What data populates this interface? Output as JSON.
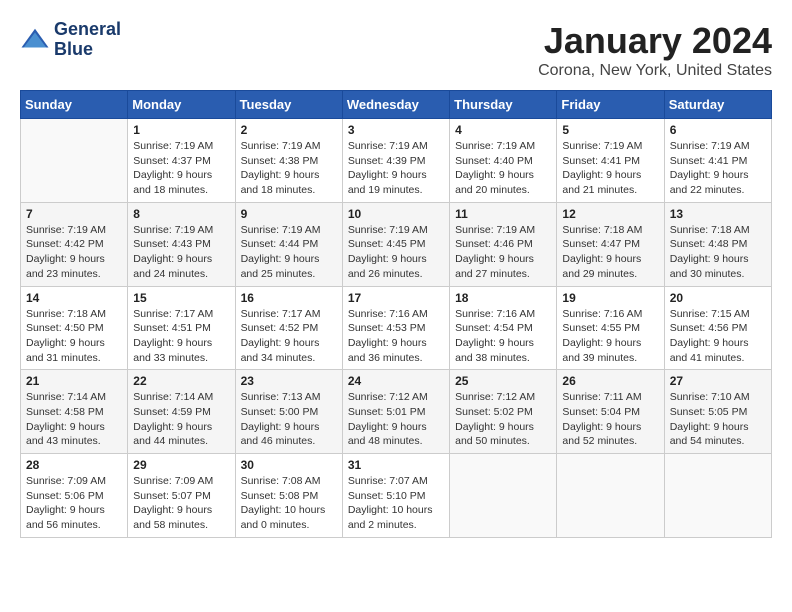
{
  "header": {
    "logo_line1": "General",
    "logo_line2": "Blue",
    "month": "January 2024",
    "location": "Corona, New York, United States"
  },
  "weekdays": [
    "Sunday",
    "Monday",
    "Tuesday",
    "Wednesday",
    "Thursday",
    "Friday",
    "Saturday"
  ],
  "weeks": [
    [
      {
        "day": "",
        "sunrise": "",
        "sunset": "",
        "daylight": ""
      },
      {
        "day": "1",
        "sunrise": "7:19 AM",
        "sunset": "4:37 PM",
        "daylight": "9 hours and 18 minutes."
      },
      {
        "day": "2",
        "sunrise": "7:19 AM",
        "sunset": "4:38 PM",
        "daylight": "9 hours and 18 minutes."
      },
      {
        "day": "3",
        "sunrise": "7:19 AM",
        "sunset": "4:39 PM",
        "daylight": "9 hours and 19 minutes."
      },
      {
        "day": "4",
        "sunrise": "7:19 AM",
        "sunset": "4:40 PM",
        "daylight": "9 hours and 20 minutes."
      },
      {
        "day": "5",
        "sunrise": "7:19 AM",
        "sunset": "4:41 PM",
        "daylight": "9 hours and 21 minutes."
      },
      {
        "day": "6",
        "sunrise": "7:19 AM",
        "sunset": "4:41 PM",
        "daylight": "9 hours and 22 minutes."
      }
    ],
    [
      {
        "day": "7",
        "sunrise": "7:19 AM",
        "sunset": "4:42 PM",
        "daylight": "9 hours and 23 minutes."
      },
      {
        "day": "8",
        "sunrise": "7:19 AM",
        "sunset": "4:43 PM",
        "daylight": "9 hours and 24 minutes."
      },
      {
        "day": "9",
        "sunrise": "7:19 AM",
        "sunset": "4:44 PM",
        "daylight": "9 hours and 25 minutes."
      },
      {
        "day": "10",
        "sunrise": "7:19 AM",
        "sunset": "4:45 PM",
        "daylight": "9 hours and 26 minutes."
      },
      {
        "day": "11",
        "sunrise": "7:19 AM",
        "sunset": "4:46 PM",
        "daylight": "9 hours and 27 minutes."
      },
      {
        "day": "12",
        "sunrise": "7:18 AM",
        "sunset": "4:47 PM",
        "daylight": "9 hours and 29 minutes."
      },
      {
        "day": "13",
        "sunrise": "7:18 AM",
        "sunset": "4:48 PM",
        "daylight": "9 hours and 30 minutes."
      }
    ],
    [
      {
        "day": "14",
        "sunrise": "7:18 AM",
        "sunset": "4:50 PM",
        "daylight": "9 hours and 31 minutes."
      },
      {
        "day": "15",
        "sunrise": "7:17 AM",
        "sunset": "4:51 PM",
        "daylight": "9 hours and 33 minutes."
      },
      {
        "day": "16",
        "sunrise": "7:17 AM",
        "sunset": "4:52 PM",
        "daylight": "9 hours and 34 minutes."
      },
      {
        "day": "17",
        "sunrise": "7:16 AM",
        "sunset": "4:53 PM",
        "daylight": "9 hours and 36 minutes."
      },
      {
        "day": "18",
        "sunrise": "7:16 AM",
        "sunset": "4:54 PM",
        "daylight": "9 hours and 38 minutes."
      },
      {
        "day": "19",
        "sunrise": "7:16 AM",
        "sunset": "4:55 PM",
        "daylight": "9 hours and 39 minutes."
      },
      {
        "day": "20",
        "sunrise": "7:15 AM",
        "sunset": "4:56 PM",
        "daylight": "9 hours and 41 minutes."
      }
    ],
    [
      {
        "day": "21",
        "sunrise": "7:14 AM",
        "sunset": "4:58 PM",
        "daylight": "9 hours and 43 minutes."
      },
      {
        "day": "22",
        "sunrise": "7:14 AM",
        "sunset": "4:59 PM",
        "daylight": "9 hours and 44 minutes."
      },
      {
        "day": "23",
        "sunrise": "7:13 AM",
        "sunset": "5:00 PM",
        "daylight": "9 hours and 46 minutes."
      },
      {
        "day": "24",
        "sunrise": "7:12 AM",
        "sunset": "5:01 PM",
        "daylight": "9 hours and 48 minutes."
      },
      {
        "day": "25",
        "sunrise": "7:12 AM",
        "sunset": "5:02 PM",
        "daylight": "9 hours and 50 minutes."
      },
      {
        "day": "26",
        "sunrise": "7:11 AM",
        "sunset": "5:04 PM",
        "daylight": "9 hours and 52 minutes."
      },
      {
        "day": "27",
        "sunrise": "7:10 AM",
        "sunset": "5:05 PM",
        "daylight": "9 hours and 54 minutes."
      }
    ],
    [
      {
        "day": "28",
        "sunrise": "7:09 AM",
        "sunset": "5:06 PM",
        "daylight": "9 hours and 56 minutes."
      },
      {
        "day": "29",
        "sunrise": "7:09 AM",
        "sunset": "5:07 PM",
        "daylight": "9 hours and 58 minutes."
      },
      {
        "day": "30",
        "sunrise": "7:08 AM",
        "sunset": "5:08 PM",
        "daylight": "10 hours and 0 minutes."
      },
      {
        "day": "31",
        "sunrise": "7:07 AM",
        "sunset": "5:10 PM",
        "daylight": "10 hours and 2 minutes."
      },
      {
        "day": "",
        "sunrise": "",
        "sunset": "",
        "daylight": ""
      },
      {
        "day": "",
        "sunrise": "",
        "sunset": "",
        "daylight": ""
      },
      {
        "day": "",
        "sunrise": "",
        "sunset": "",
        "daylight": ""
      }
    ]
  ]
}
